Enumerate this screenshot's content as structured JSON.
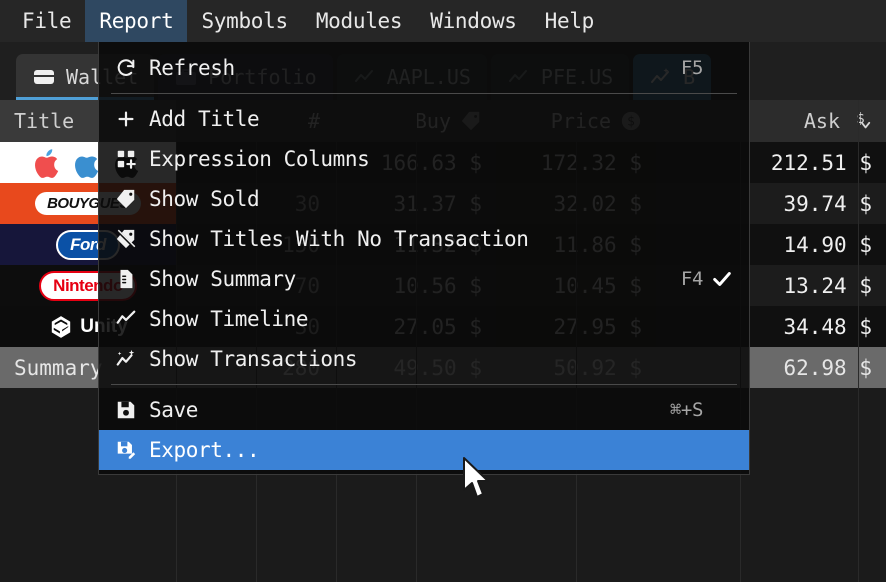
{
  "menubar": {
    "items": [
      {
        "label": "File",
        "active": false
      },
      {
        "label": "Report",
        "active": true
      },
      {
        "label": "Symbols",
        "active": false
      },
      {
        "label": "Modules",
        "active": false
      },
      {
        "label": "Windows",
        "active": false
      },
      {
        "label": "Help",
        "active": false
      }
    ]
  },
  "tabs": [
    {
      "label": "Wallet",
      "icon": "wallet-icon",
      "state": "underline"
    },
    {
      "label": "Portfolio",
      "icon": "briefcase-icon",
      "state": "dim"
    },
    {
      "label": "AAPL.US",
      "icon": "chart-icon",
      "state": "dim2"
    },
    {
      "label": "PFE.US",
      "icon": "chart-icon",
      "state": "dim2"
    },
    {
      "label": "B",
      "icon": "sparkchart-icon",
      "state": "selected"
    }
  ],
  "menu": {
    "sections": [
      {
        "items": [
          {
            "label": "Refresh",
            "icon": "refresh-icon",
            "shortcut": "F5",
            "checked": false,
            "highlight": false
          }
        ]
      },
      {
        "items": [
          {
            "label": "Add Title",
            "icon": "plus-icon",
            "shortcut": "",
            "checked": false,
            "highlight": false
          },
          {
            "label": "Expression Columns",
            "icon": "grid-plus-icon",
            "shortcut": "",
            "checked": false,
            "highlight": false
          },
          {
            "label": "Show Sold",
            "icon": "tag-icon",
            "shortcut": "",
            "checked": false,
            "highlight": false
          },
          {
            "label": "Show Titles With No Transaction",
            "icon": "tag-slash-icon",
            "shortcut": "",
            "checked": false,
            "highlight": false
          },
          {
            "label": "Show Summary",
            "icon": "document-icon",
            "shortcut": "F4",
            "checked": true,
            "highlight": false
          },
          {
            "label": "Show Timeline",
            "icon": "line-chart-icon",
            "shortcut": "",
            "checked": false,
            "highlight": false
          },
          {
            "label": "Show Transactions",
            "icon": "sparkchart-icon",
            "shortcut": "",
            "checked": false,
            "highlight": false
          }
        ]
      },
      {
        "items": [
          {
            "label": "Save",
            "icon": "floppy-icon",
            "shortcut": "⌘+S",
            "checked": false,
            "highlight": false
          },
          {
            "label": "Export...",
            "icon": "floppy-edit-icon",
            "shortcut": "",
            "checked": false,
            "highlight": true
          }
        ]
      }
    ]
  },
  "table": {
    "headers": [
      {
        "label": "Title",
        "icon": ""
      },
      {
        "label": "#",
        "icon": ""
      },
      {
        "label": "Buy",
        "icon": "tag-icon"
      },
      {
        "label": "Price",
        "icon": "dollar-circle-icon"
      },
      {
        "label": "Ask",
        "icon": "currency-sort-icon"
      }
    ],
    "rows": [
      {
        "logo": "apple",
        "logo_text": "",
        "qty": "",
        "buy": "166.63 $",
        "price": "172.32 $",
        "ask": "212.51 $"
      },
      {
        "logo": "bouygues",
        "logo_text": "BOUYGUES",
        "qty": "30",
        "buy": "31.37 $",
        "price": "32.02 $",
        "ask": "39.74 $"
      },
      {
        "logo": "ford",
        "logo_text": "Ford",
        "qty": "150",
        "buy": "11.32 $",
        "price": "11.86 $",
        "ask": "14.90 $"
      },
      {
        "logo": "nintendo",
        "logo_text": "Nintendo",
        "qty": "70",
        "buy": "10.56 $",
        "price": "10.45 $",
        "ask": "13.24 $"
      },
      {
        "logo": "unity",
        "logo_text": "Unity",
        "qty": "30",
        "buy": "27.05 $",
        "price": "27.95 $",
        "ask": "34.48 $"
      }
    ],
    "summary": {
      "label": "Summary",
      "qty": "280",
      "buy": "49.50 $",
      "price": "50.92 $",
      "ask": "62.98 $"
    }
  },
  "colors": {
    "accent_highlight": "#3b82d6",
    "menubar_active": "#2f4861",
    "tab_selected": "#32749c",
    "tab_underline": "#4f9fd6",
    "summary_row": "#6a6a6a"
  }
}
